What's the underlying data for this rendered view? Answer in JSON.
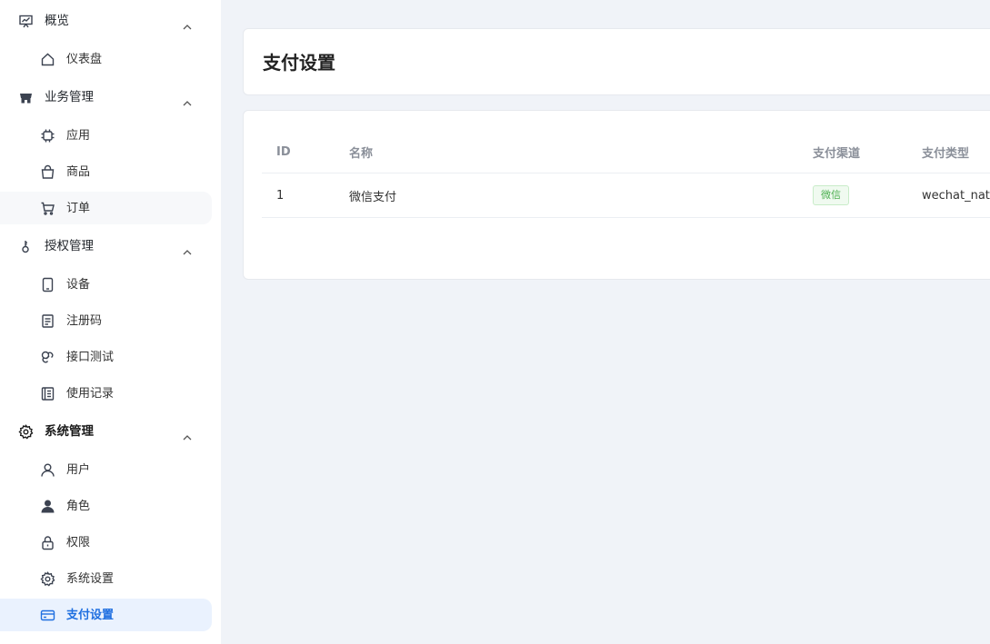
{
  "sidebar": {
    "groups": [
      {
        "label": "概览",
        "icon": "presentation-chart-icon",
        "items": [
          {
            "label": "仪表盘",
            "icon": "home-icon"
          }
        ]
      },
      {
        "label": "业务管理",
        "icon": "store-icon",
        "items": [
          {
            "label": "应用",
            "icon": "chip-icon"
          },
          {
            "label": "商品",
            "icon": "shopping-bag-icon"
          },
          {
            "label": "订单",
            "icon": "cart-icon"
          }
        ]
      },
      {
        "label": "授权管理",
        "icon": "key-icon",
        "items": [
          {
            "label": "设备",
            "icon": "tablet-icon"
          },
          {
            "label": "注册码",
            "icon": "document-icon"
          },
          {
            "label": "接口测试",
            "icon": "link-icon"
          },
          {
            "label": "使用记录",
            "icon": "notebook-icon"
          }
        ]
      },
      {
        "label": "系统管理",
        "icon": "gear-icon",
        "items": [
          {
            "label": "用户",
            "icon": "user-outline-icon"
          },
          {
            "label": "角色",
            "icon": "user-solid-icon"
          },
          {
            "label": "权限",
            "icon": "lock-icon"
          },
          {
            "label": "系统设置",
            "icon": "gear-icon"
          },
          {
            "label": "支付设置",
            "icon": "credit-card-icon"
          }
        ]
      }
    ]
  },
  "page": {
    "title": "支付设置"
  },
  "table": {
    "headers": [
      "ID",
      "名称",
      "支付渠道",
      "支付类型"
    ],
    "rows": [
      {
        "id": "1",
        "name": "微信支付",
        "channel": "微信",
        "type": "wechat_native"
      }
    ]
  },
  "colors": {
    "accent": "#1f6fe0",
    "active_bg": "#eaf2fe",
    "badge_green": "#4caf50",
    "page_bg": "#f0f3f8"
  }
}
